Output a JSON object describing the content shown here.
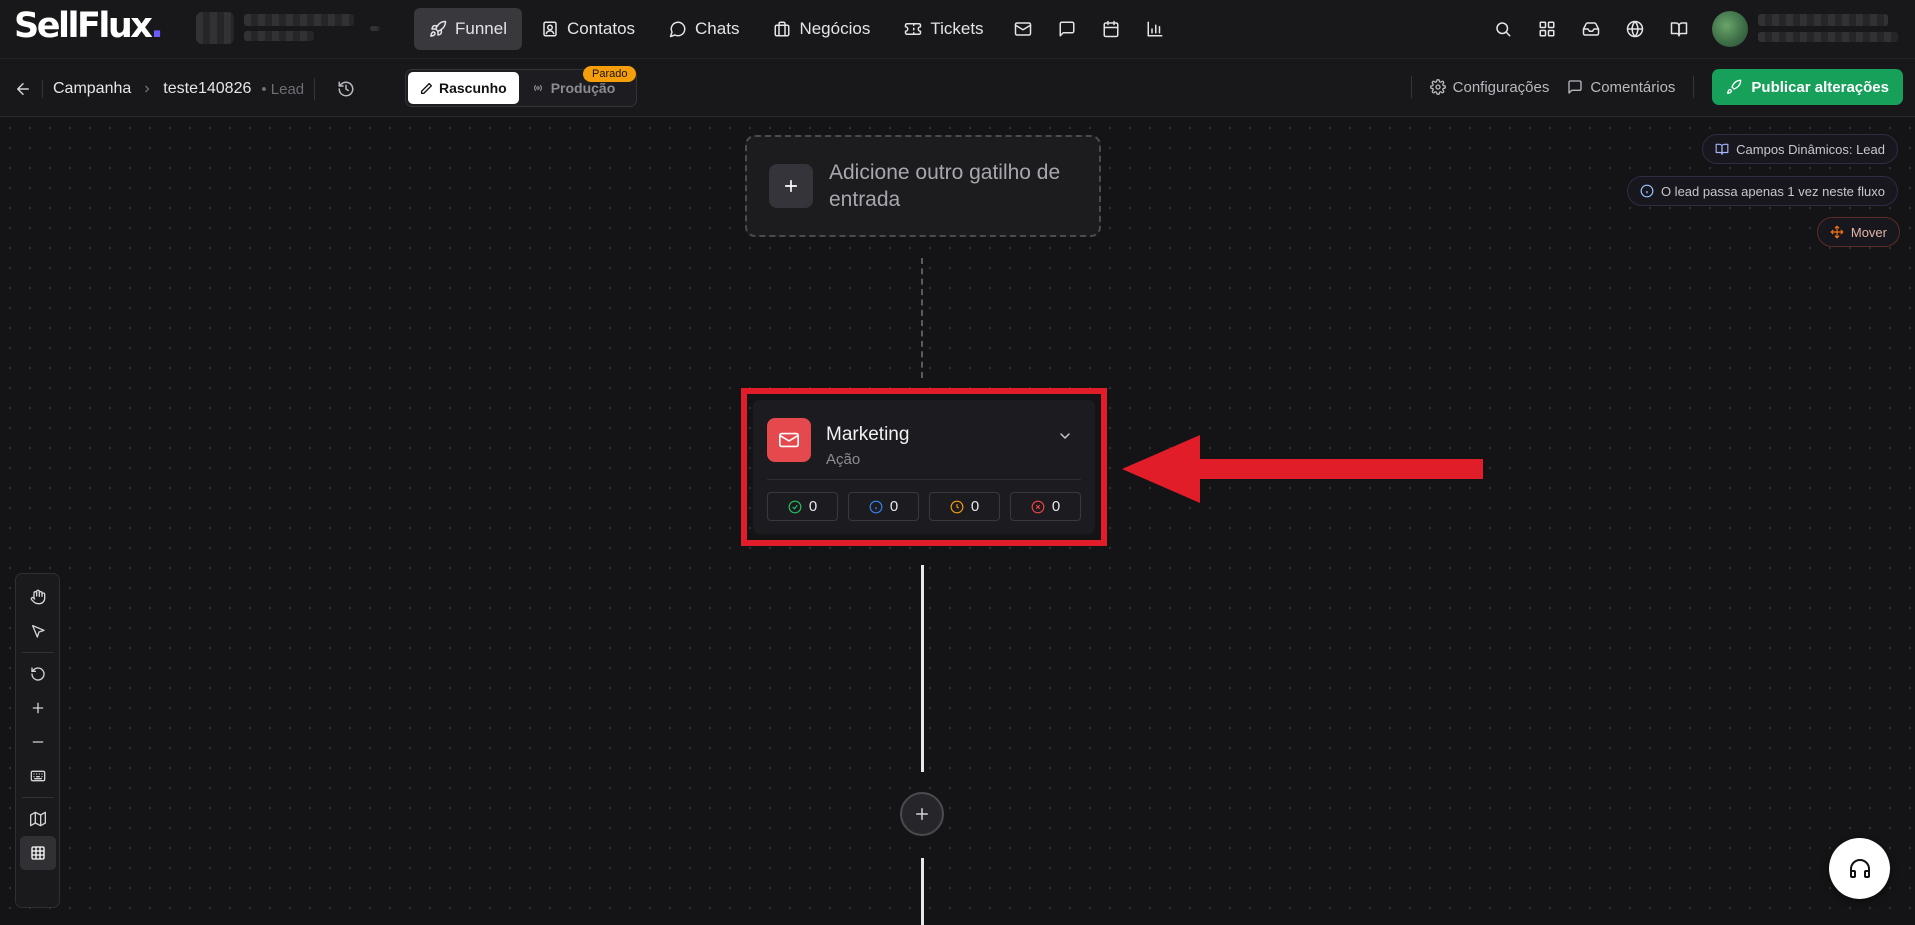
{
  "app": {
    "logo_text": "SellFlux",
    "logo_dot": "."
  },
  "nav": {
    "items": [
      {
        "label": "Funnel",
        "icon": "rocket-icon",
        "active": true
      },
      {
        "label": "Contatos",
        "icon": "contacts-icon"
      },
      {
        "label": "Chats",
        "icon": "chat-icon"
      },
      {
        "label": "Negócios",
        "icon": "briefcase-icon"
      },
      {
        "label": "Tickets",
        "icon": "ticket-icon"
      }
    ],
    "extra_icons": [
      "mail-icon",
      "message-square-icon",
      "calendar-icon",
      "bar-chart-icon"
    ],
    "right_icons": [
      "search-icon",
      "grid-icon",
      "inbox-icon",
      "globe-icon",
      "book-icon",
      "headset-icon"
    ]
  },
  "subbar": {
    "breadcrumb": {
      "root": "Campanha",
      "current": "teste140826",
      "tag": "Lead"
    },
    "modes": {
      "draft": "Rascunho",
      "production": "Produção",
      "production_badge": "Parado"
    },
    "settings_label": "Configurações",
    "comments_label": "Comentários",
    "publish_label": "Publicar alterações"
  },
  "canvas": {
    "trigger_placeholder": "Adicione outro gatilho de entrada",
    "node": {
      "title": "Marketing",
      "subtitle": "Ação",
      "stats": {
        "success": "0",
        "info": "0",
        "pending": "0",
        "error": "0"
      }
    },
    "chips": {
      "dynamic_fields": "Campos Dinâmicos: Lead",
      "flow_info": "O lead passa apenas 1 vez neste fluxo",
      "move": "Mover"
    }
  },
  "colors": {
    "accent_green": "#16a05a",
    "badge_orange": "#f59e0b",
    "node_icon_red": "#e5484d",
    "highlight_red": "#e11d2a"
  }
}
